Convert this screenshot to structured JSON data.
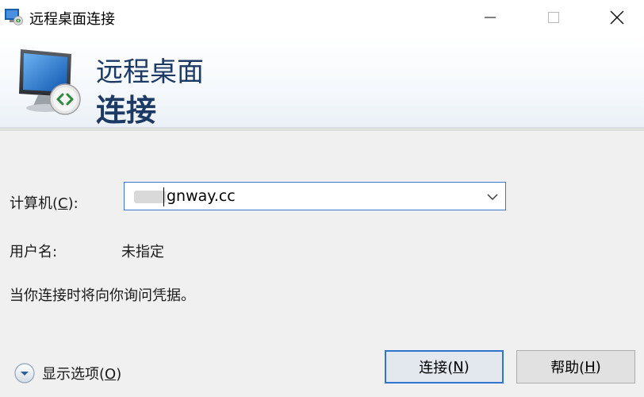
{
  "window": {
    "title": "远程桌面连接",
    "controls": {
      "minimize": "minimize",
      "maximize": "maximize",
      "close": "close"
    }
  },
  "banner": {
    "line1": "远程桌面",
    "line2": "连接"
  },
  "computer": {
    "label_before": "计算机(",
    "label_mnemonic": "C",
    "label_after": "):",
    "value_visible": "gnway.cc",
    "value_obscured": true
  },
  "username": {
    "label": "用户名:",
    "value": "未指定"
  },
  "note": "当你连接时将向你询问凭据。",
  "options": {
    "label_before": "显示选项(",
    "label_mnemonic": "O",
    "label_after": ")"
  },
  "buttons": {
    "connect": {
      "label_before": "连接(",
      "mnemonic": "N",
      "label_after": ")"
    },
    "help": {
      "label_before": "帮助(",
      "mnemonic": "H",
      "label_after": ")"
    }
  },
  "colors": {
    "accent": "#2f74d0",
    "banner_text": "#1c3a64",
    "background": "#f0f0f0"
  },
  "icons": [
    "rdp-app-icon",
    "minimize-icon",
    "maximize-icon",
    "close-icon",
    "monitor-connect-icon",
    "chevron-down-icon",
    "expand-options-icon"
  ]
}
